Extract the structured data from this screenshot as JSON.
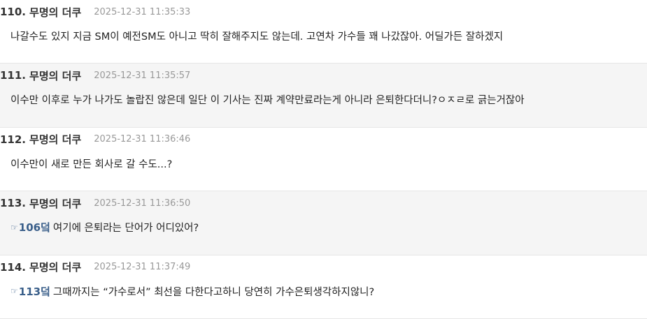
{
  "comments": [
    {
      "number": "110.",
      "author": "무명의 더쿠",
      "time": "2025-12-31 11:35:33",
      "text": "나갈수도 있지 지금 SM이 예전SM도 아니고 딱히 잘해주지도 않는데. 고연차 가수들 꽤 나갔잖아. 어딜가든 잘하겠지"
    },
    {
      "number": "111.",
      "author": "무명의 더쿠",
      "time": "2025-12-31 11:35:57",
      "text": "이수만 이후로 누가 나가도 놀랍진 않은데 일단 이 기사는 진짜 계약만료라는게 아니라 은퇴한다더니?ㅇㅈㄹ로 긁는거잖아"
    },
    {
      "number": "112.",
      "author": "무명의 더쿠",
      "time": "2025-12-31 11:36:46",
      "text": "이수만이 새로 만든 회사로 갈 수도...?"
    },
    {
      "number": "113.",
      "author": "무명의 더쿠",
      "time": "2025-12-31 11:36:50",
      "reply_icon": "pointing-hand-icon",
      "reply_to": "106덬",
      "text": "여기에 은퇴라는 단어가 어디있어?"
    },
    {
      "number": "114.",
      "author": "무명의 더쿠",
      "time": "2025-12-31 11:37:49",
      "reply_icon": "pointing-hand-icon",
      "reply_to": "113덬",
      "text": "그때까지는 “가수로서” 최선을 다한다고하니 당연히 가수은퇴생각하지않니?"
    }
  ],
  "colors": {
    "alt_row_background": "#f5f5f5",
    "reply_link": "#3a5f8a",
    "timestamp": "#999999",
    "divider": "#e6e6e6"
  }
}
